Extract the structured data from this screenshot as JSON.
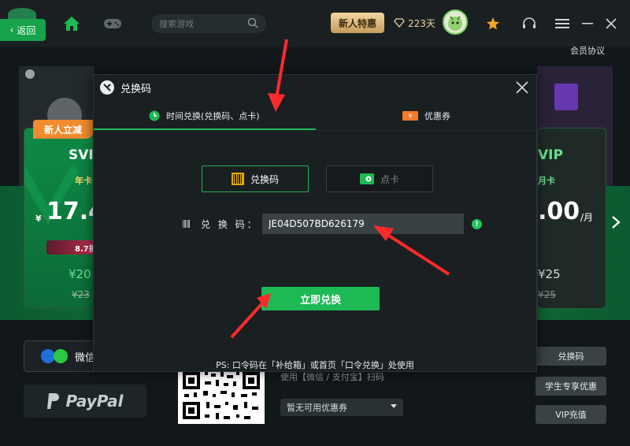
{
  "topbar": {
    "back_label": "返回",
    "search_placeholder": "搜索游戏",
    "promo_label": "新人特惠",
    "days_label": "223天",
    "member_link": "会员协议"
  },
  "background": {
    "new_user_tag": "新人立减",
    "left_card": {
      "title": "SVI",
      "subtitle": "年卡",
      "currency": "¥",
      "price": "17.4",
      "discount": "8.7折",
      "sale": "¥20",
      "orig": "¥23"
    },
    "right_card": {
      "title": "VIP",
      "subtitle": "月卡",
      "price": ".00",
      "unit": "/月",
      "sale": "¥25",
      "orig": "¥25"
    },
    "pay_wechat_label": "微信",
    "paypal_label": "PayPal",
    "use_text": "使用【微信 / 支付宝】扫码",
    "coupon_select": "暂无可用优惠券",
    "side_buttons": [
      "兑换码",
      "学生专享优惠",
      "VIP充值"
    ]
  },
  "modal": {
    "title": "兑换码",
    "tabs": [
      {
        "label": "时间兑换(兑换码、点卡)",
        "active": true
      },
      {
        "label": "优惠券",
        "active": false
      }
    ],
    "switches": [
      {
        "label": "兑换码",
        "active": true
      },
      {
        "label": "点卡",
        "active": false
      }
    ],
    "field_label": "兑 换 码：",
    "code_value": "JE04D507BD626179",
    "redeem_button": "立即兑换",
    "ps_note": "PS: 口令码在「补给箱」或首页「口令兑换」处使用"
  },
  "colors": {
    "accent": "#1db954",
    "annotation": "#ff2a2a",
    "promo": "#e4c28a"
  }
}
